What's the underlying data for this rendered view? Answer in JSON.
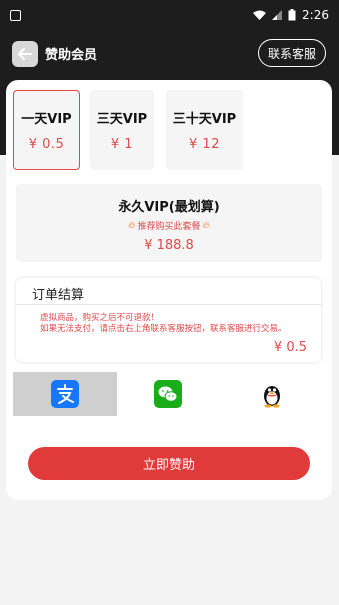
{
  "status_bar": {
    "time": "2:26"
  },
  "header": {
    "title": "赞助会员",
    "support_button": "联系客服"
  },
  "plans": [
    {
      "name": "一天VIP",
      "price": "¥ 0.5",
      "selected": true
    },
    {
      "name": "三天VIP",
      "price": "¥ 1",
      "selected": false
    },
    {
      "name": "三十天VIP",
      "price": "¥ 12",
      "selected": false
    }
  ],
  "lifetime": {
    "name": "永久VIP(最划算)",
    "recommend": "推荐购买此套餐",
    "price": "¥ 188.8"
  },
  "order": {
    "title": "订单结算",
    "notes": [
      "虚拟商品，购买之后不可退款！",
      "如果无法支付，请点击右上角联系客服按钮，联系客服进行交易。"
    ],
    "total": "¥ 0.5"
  },
  "payment": {
    "options": [
      {
        "icon": "alipay-icon",
        "selected": true
      },
      {
        "icon": "wechat-icon",
        "selected": false
      },
      {
        "icon": "qq-icon",
        "selected": false
      }
    ]
  },
  "submit_button": "立即赞助",
  "colors": {
    "accent": "#e04a4a",
    "button": "#e03a3a",
    "alipay": "#1677ff",
    "wechat": "#1aad19",
    "header_bg": "#1d1d1d"
  }
}
